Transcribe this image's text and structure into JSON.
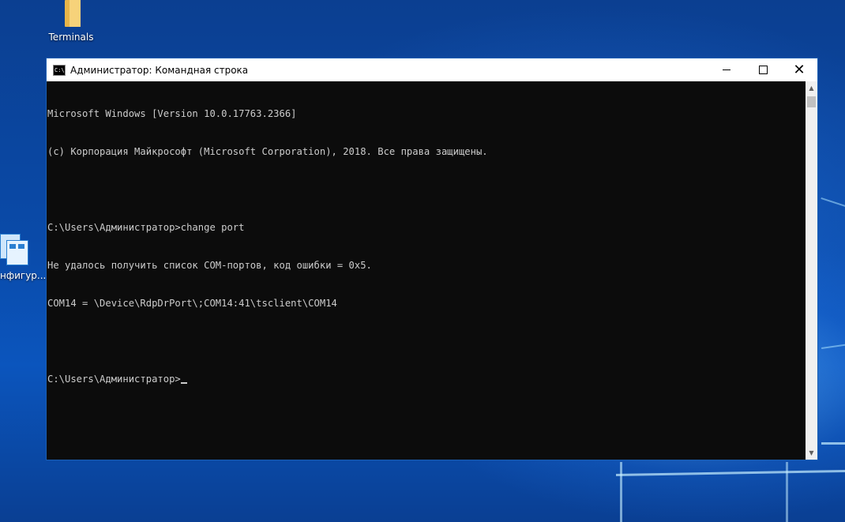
{
  "desktop": {
    "icons": [
      {
        "label": "Terminals",
        "icon": "folder-icon"
      },
      {
        "label": "нфигур...",
        "icon": "server-config-icon"
      }
    ]
  },
  "window": {
    "title": "Администратор: Командная строка",
    "app_icon": "cmd-icon",
    "app_icon_text": "C:\\.",
    "buttons": {
      "minimize": "minimize-icon",
      "maximize": "maximize-icon",
      "close": "✕"
    }
  },
  "console": {
    "lines": [
      "Microsoft Windows [Version 10.0.17763.2366]",
      "(c) Корпорация Майкрософт (Microsoft Corporation), 2018. Все права защищены.",
      "",
      "C:\\Users\\Администратор>change port",
      "Не удалось получить список COM-портов, код ошибки = 0x5.",
      "COM14 = \\Device\\RdpDrPort\\;COM14:41\\tsclient\\COM14",
      "",
      "C:\\Users\\Администратор>"
    ]
  },
  "scrollbar": {
    "up_arrow": "▲",
    "down_arrow": "▼"
  },
  "colors": {
    "console_bg": "#0c0c0c",
    "console_text": "#cccccc",
    "titlebar_bg": "#ffffff"
  }
}
